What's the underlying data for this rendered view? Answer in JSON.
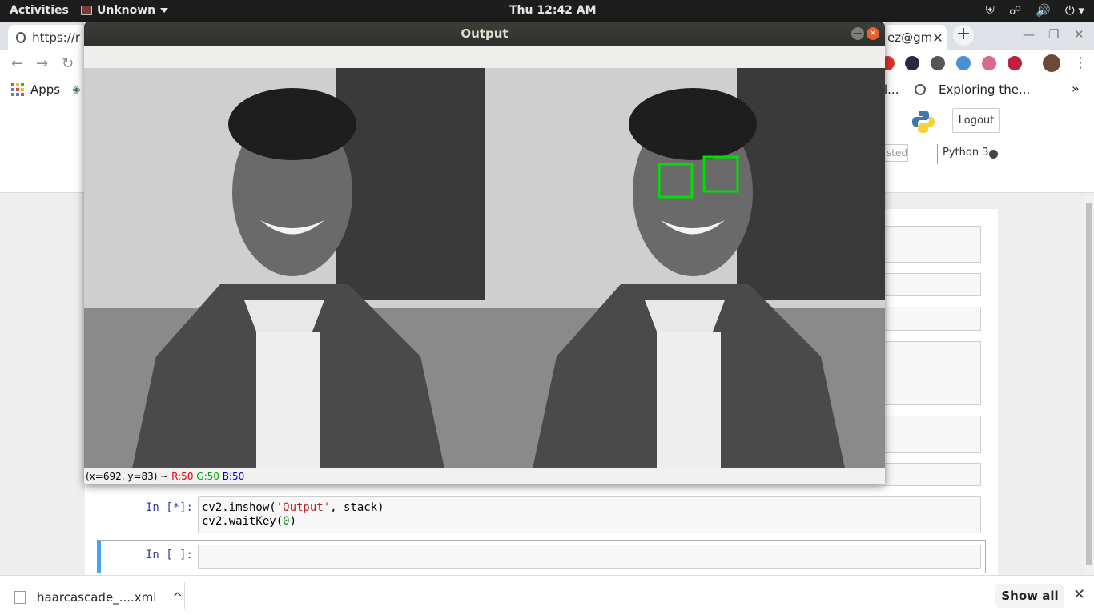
{
  "topbar": {
    "activities": "Activities",
    "app_name": "Unknown",
    "clock": "Thu 12:42 AM"
  },
  "chrome": {
    "tab_left_label": "https://r",
    "tab_right_label": "ez@gm",
    "bookmarks": {
      "apps": "Apps",
      "partial": "l...",
      "exploring": "Exploring the..."
    }
  },
  "jupyter": {
    "logout": "Logout",
    "trusted_partial": "sted",
    "kernel": "Python 3",
    "cells": [
      {
        "prompt": "In [*]:",
        "line1_a": "cv2.imshow(",
        "line1_s": "'Output'",
        "line1_b": ", stack)",
        "line2_a": "cv2.waitKey(",
        "line2_n": "0",
        "line2_b": ")"
      },
      {
        "prompt": "In [ ]:"
      }
    ]
  },
  "output_window": {
    "title": "Output",
    "status": {
      "coords": "(x=692, y=83) ~ ",
      "r": "R:50",
      "g": "G:50",
      "b": "B:50"
    }
  },
  "download_shelf": {
    "filename": "haarcascade_....xml",
    "show_all": "Show all"
  },
  "colors": {
    "detection_box": "#00e000",
    "jupyter_prompt": "#303f9f",
    "selected_cell_bar": "#42a5f5"
  }
}
